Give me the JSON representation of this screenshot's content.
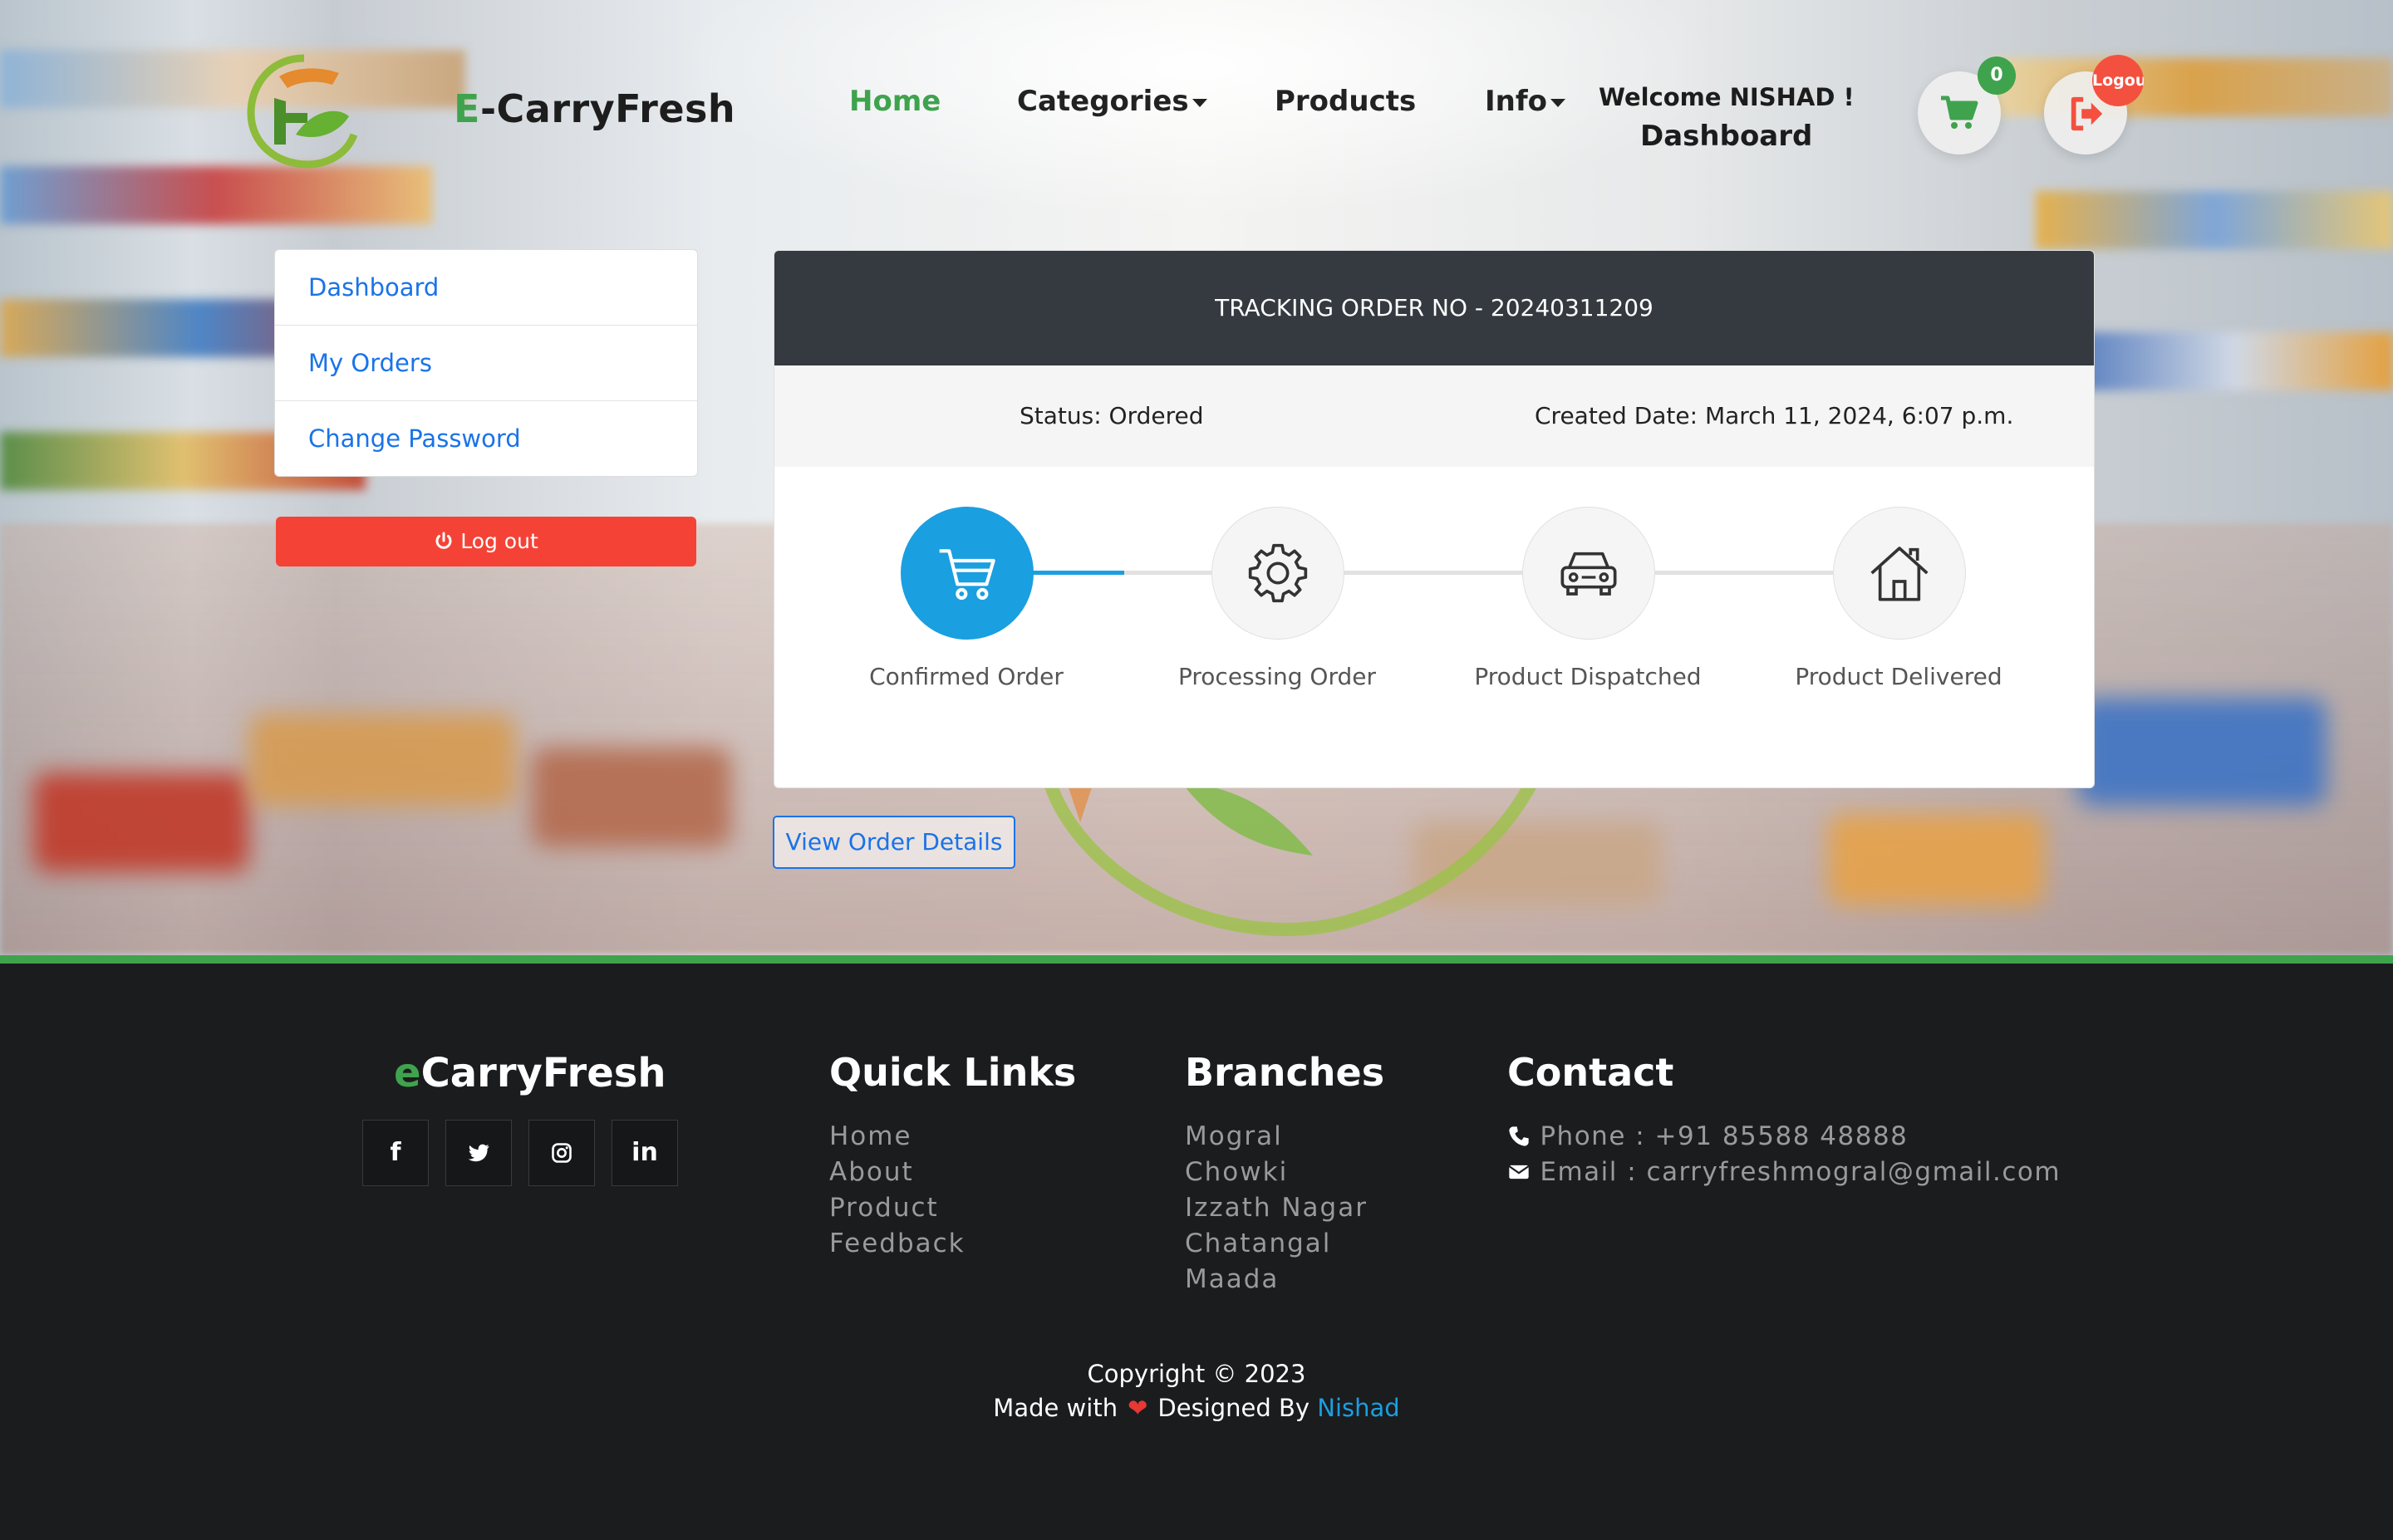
{
  "header": {
    "brand_prefix": "E",
    "brand_rest": "-CarryFresh",
    "nav": {
      "home": "Home",
      "categories": "Categories",
      "products": "Products",
      "info": "Info"
    },
    "welcome": "Welcome NISHAD !",
    "dashboard": "Dashboard",
    "cart_count": "0",
    "logout_badge": "Logout",
    "icons": [
      "cart-icon",
      "logout-icon"
    ]
  },
  "sidebar": {
    "items": [
      {
        "label": "Dashboard"
      },
      {
        "label": "My Orders"
      },
      {
        "label": "Change Password"
      }
    ],
    "logout_label": "Log out"
  },
  "tracking": {
    "title": "TRACKING ORDER NO - 20240311209",
    "status": "Status: Ordered",
    "created": "Created Date: March 11, 2024, 6:07 p.m.",
    "steps": [
      {
        "label": "Confirmed Order",
        "icon": "cart-icon",
        "active": true
      },
      {
        "label": "Processing Order",
        "icon": "gear-icon",
        "active": false
      },
      {
        "label": "Product Dispatched",
        "icon": "car-icon",
        "active": false
      },
      {
        "label": "Product Delivered",
        "icon": "home-icon",
        "active": false
      }
    ],
    "view_details": "View Order Details"
  },
  "footer": {
    "brand_prefix": "e",
    "brand_rest": "CarryFresh",
    "social": [
      "facebook-icon",
      "twitter-icon",
      "instagram-icon",
      "linkedin-icon"
    ],
    "quick_links": {
      "heading": "Quick Links",
      "items": [
        "Home",
        "About",
        "Product",
        "Feedback"
      ]
    },
    "branches": {
      "heading": "Branches",
      "items": [
        "Mogral",
        "Chowki",
        "Izzath Nagar",
        "Chatangal",
        "Maada"
      ]
    },
    "contact": {
      "heading": "Contact",
      "phone": "Phone : +91 85588 48888",
      "email": "Email : carryfreshmogral@gmail.com"
    },
    "copyright": "Copyright © 2023",
    "made_with": "Made with",
    "designed_by": "Designed By",
    "author": "Nishad"
  },
  "colors": {
    "accent_green": "#3fa34d",
    "accent_blue": "#1a9fe0",
    "link_blue": "#1a73e8",
    "danger": "#f44336",
    "dark": "#343a40",
    "footer_bg": "#1b1c1e"
  }
}
